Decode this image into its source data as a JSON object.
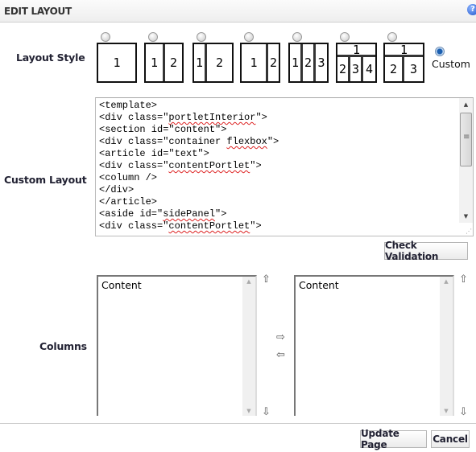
{
  "header": {
    "title": "EDIT LAYOUT",
    "help_icon": "help-icon"
  },
  "layout_style": {
    "label": "Layout Style",
    "options": [
      {
        "name": "one-column",
        "cells": [
          "1"
        ],
        "selected": false
      },
      {
        "name": "two-column-equal",
        "cells": [
          "1",
          "2"
        ],
        "selected": false
      },
      {
        "name": "two-column-narrow-wide",
        "cells": [
          "1",
          "2"
        ],
        "selected": false
      },
      {
        "name": "two-column-wide-narrow",
        "cells": [
          "1",
          "2"
        ],
        "selected": false
      },
      {
        "name": "three-column",
        "cells": [
          "1",
          "2",
          "3"
        ],
        "selected": false
      },
      {
        "name": "one-over-three",
        "cells": [
          "1",
          "2",
          "3",
          "4"
        ],
        "selected": false
      },
      {
        "name": "one-over-two",
        "cells": [
          "1",
          "2",
          "3"
        ],
        "selected": false
      }
    ],
    "custom_label": "Custom",
    "custom_selected": true
  },
  "custom_layout": {
    "label": "Custom Layout",
    "lines": [
      "<template>",
      "<div class=\"portletInterior\">",
      "<section id=\"content\">",
      "<div class=\"container flexbox\">",
      "<article id=\"text\">",
      "<div class=\"contentPortlet\">",
      "<column />",
      "</div>",
      "</article>",
      "<aside id=\"sidePanel\">",
      "<div class=\"contentPortlet\">"
    ],
    "check_validation_label": "Check Validation"
  },
  "columns": {
    "label": "Columns",
    "left_list": [
      "Content"
    ],
    "right_list": [
      "Content"
    ]
  },
  "footer": {
    "update_label": "Update Page",
    "cancel_label": "Cancel"
  }
}
